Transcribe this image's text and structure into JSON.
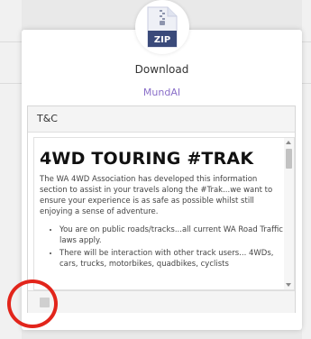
{
  "download_dialog": {
    "file_icon_label": "ZIP",
    "title": "Download",
    "owner": "MundAI"
  },
  "terms": {
    "header": "T&C",
    "heading": "4WD TOURING #TRAK",
    "intro": "The WA 4WD Association has developed this information section to assist in your travels along the #Trak...we want to ensure your experience is as safe as possible whilst still enjoying a sense of adventure.",
    "bullets": [
      "You are on public roads/tracks...all current WA Road Traffic laws apply.",
      "There will be interaction with other track users... 4WDs, cars, trucks, motorbikes, quadbikes, cyclists"
    ]
  },
  "colors": {
    "accent": "#8a6fc9",
    "annotation": "#e2251b",
    "icon_blue": "#3a4a7a"
  }
}
